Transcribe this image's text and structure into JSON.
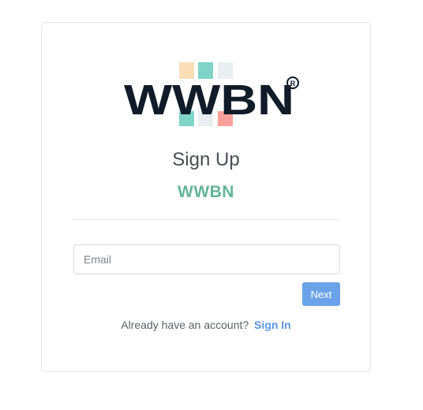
{
  "logo": {
    "text": "WWBN",
    "registered_mark": "R",
    "colors": {
      "text": "#101c27",
      "tile_orange": "#f8dfb6",
      "tile_teal": "#7fd3c7",
      "tile_light": "#e9eef0",
      "tile_red": "#f7a19a"
    }
  },
  "page": {
    "title": "Sign Up",
    "subtitle": "WWBN"
  },
  "form": {
    "email_placeholder": "Email",
    "email_value": "",
    "next_label": "Next"
  },
  "footer": {
    "prompt": "Already have an account?",
    "link_label": "Sign In"
  },
  "colors": {
    "accent_green": "#63b49a",
    "button_blue": "#6aa3ea",
    "link_blue": "#5a98e4"
  }
}
